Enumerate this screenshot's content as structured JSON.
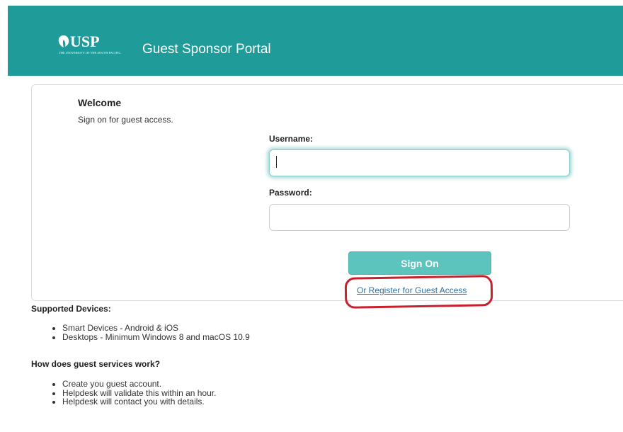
{
  "header": {
    "logo_text": "USP",
    "logo_subtext": "The University of the South Pacific",
    "title": "Guest Sponsor Portal",
    "color": "#1f9c9a"
  },
  "login": {
    "welcome": "Welcome",
    "subtitle": "Sign on for guest access.",
    "username_label": "Username:",
    "username_value": "",
    "password_label": "Password:",
    "password_value": "",
    "signon_label": "Sign On",
    "register_link": "Or Register for Guest Access",
    "button_color": "#5cc3bd",
    "highlight_color": "#c8202c"
  },
  "supported": {
    "title": "Supported Devices:",
    "items": [
      "Smart Devices - Android & iOS",
      "Desktops - Minimum Windows 8 and macOS 10.9"
    ]
  },
  "howto": {
    "title": "How does guest services work?",
    "items": [
      "Create you guest account.",
      "Helpdesk will validate this within an hour.",
      "Helpdesk will contact you with details."
    ]
  }
}
